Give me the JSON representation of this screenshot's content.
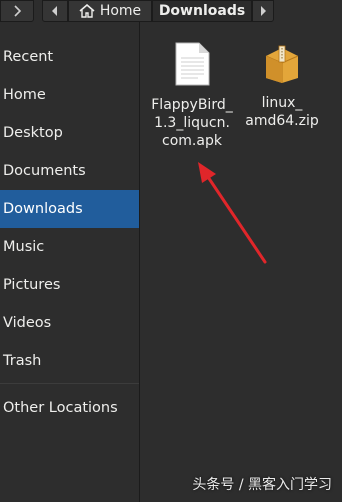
{
  "toolbar": {
    "forward_icon": "chevron-right-icon",
    "back_icon": "chevron-left-icon",
    "home_label": "Home",
    "downloads_label": "Downloads",
    "more_icon": "chevron-right-icon"
  },
  "sidebar": {
    "items": [
      {
        "label": "Recent"
      },
      {
        "label": "Home"
      },
      {
        "label": "Desktop"
      },
      {
        "label": "Documents"
      },
      {
        "label": "Downloads",
        "selected": true
      },
      {
        "label": "Music"
      },
      {
        "label": "Pictures"
      },
      {
        "label": "Videos"
      },
      {
        "label": "Trash"
      },
      {
        "label": "Other Locations"
      }
    ]
  },
  "files": [
    {
      "name": "FlappyBird_\n1.3_liqucn.\ncom.apk",
      "icon": "document-icon"
    },
    {
      "name": "linux_\namd64.zip",
      "icon": "archive-icon"
    }
  ],
  "annotation": {
    "color": "#e0262a"
  },
  "watermark": "头条号 / 黑客入门学习",
  "colors": {
    "background": "#2d2d2d",
    "selected": "#215d9c",
    "text": "#eeeeec"
  }
}
